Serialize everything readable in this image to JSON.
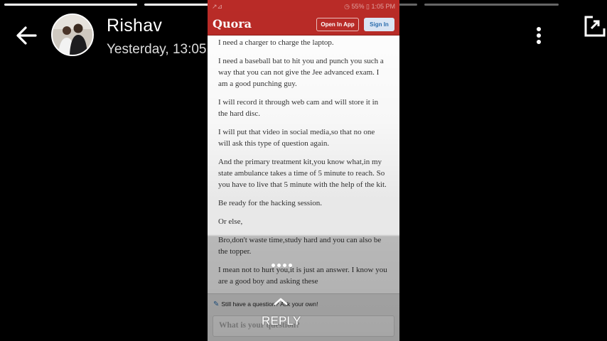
{
  "story": {
    "progress": [
      1.0,
      1.0,
      0.0,
      0.0
    ],
    "header": {
      "name": "Rishav",
      "time": "Yesterday, 13:05"
    },
    "reply_label": "REPLY",
    "icons": [
      "back-arrow-icon",
      "more-vertical-icon",
      "share-icon",
      "chevron-up-icon"
    ]
  },
  "screenshot": {
    "status_bar": {
      "left": "↗⊿",
      "right": "◷ 55% ▯ 1:05 PM"
    },
    "quora": {
      "logo": "Quora",
      "open_in_app": "Open In App",
      "sign_in": "Sign In"
    },
    "paragraphs": [
      "I need a charger to charge the laptop.",
      "I need a baseball bat to hit you and punch you such a way that you can not give the Jee advanced exam. I am a good punching guy.",
      "I will record it through web cam and will store it in the hard disc.",
      "I will put that video in social media,so that no one will ask this type of question again.",
      "And the primary treatment kit,you know what,in my state ambulance takes a time of 5 minute to reach. So you have to live that 5 minute with the help of the kit.",
      "Be ready for the hacking session.",
      "Or else,",
      "Bro,don't waste time,study hard and you can also be the topper.",
      "I mean not to hurt you,it is just an answer. I know you are a good boy and asking these"
    ],
    "ask": {
      "link": "Still have a question? Ask your own!",
      "placeholder": "What is your question?"
    },
    "colors": {
      "brand": "#b92b27",
      "link": "#2b6dad"
    }
  }
}
